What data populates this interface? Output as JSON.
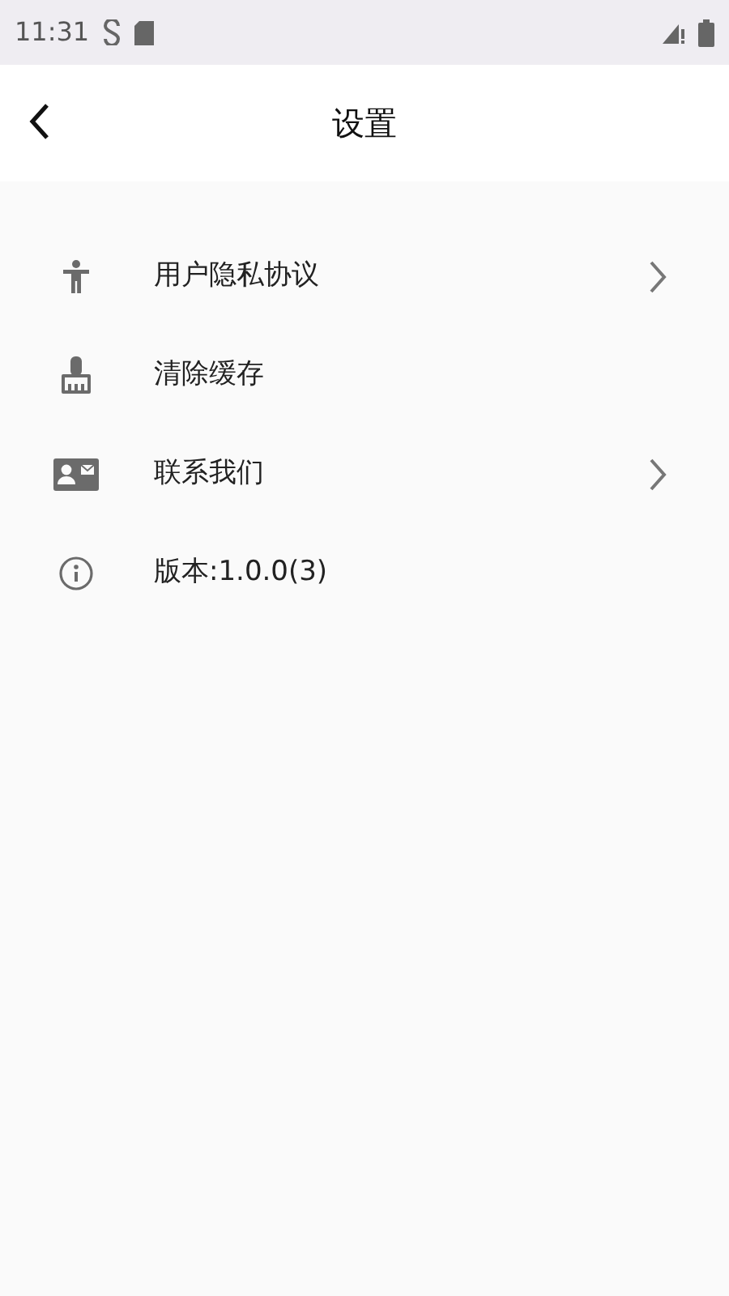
{
  "status_bar": {
    "time": "11:31"
  },
  "header": {
    "title": "设置"
  },
  "items": [
    {
      "kind": "accessibility",
      "label": "用户隐私协议",
      "chevron": true
    },
    {
      "kind": "broom",
      "label": "清除缓存",
      "chevron": false
    },
    {
      "kind": "contact",
      "label": "联系我们",
      "chevron": true
    },
    {
      "kind": "info",
      "label": "版本:1.0.0(3)",
      "chevron": false
    }
  ]
}
